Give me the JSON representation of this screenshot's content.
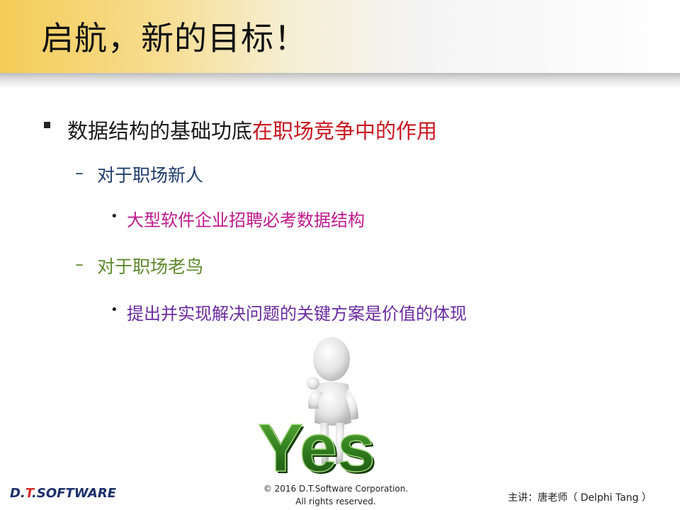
{
  "title": "启航，新的目标！",
  "points": {
    "p1_plain": "数据结构的基础功底",
    "p1_highlight": "在职场竞争中的作用",
    "p2": "对于职场新人",
    "p3": "大型软件企业招聘必考数据结构",
    "p4": "对于职场老鸟",
    "p5": "提出并实现解决问题的关键方案是价值的体现",
    "dash": "–",
    "dot": "•"
  },
  "illustration": {
    "word": "Yes"
  },
  "footer": {
    "logo_prefix": "D.",
    "logo_t": "T",
    "logo_suffix": ".SOFTWARE",
    "copyright_line1": "© 2016 D.T.Software Corporation.",
    "copyright_line2": "All rights reserved.",
    "speaker": "主讲：唐老师（ Delphi Tang ）"
  },
  "colors": {
    "title_bar_left": "#f4cc57",
    "highlight_red": "#c8141e",
    "newcomer_blue": "#1f3c6e",
    "magenta": "#c0198c",
    "veteran_green": "#5f8a2d",
    "purple": "#6a2aa0",
    "yes_green": "#2f7a1e"
  }
}
